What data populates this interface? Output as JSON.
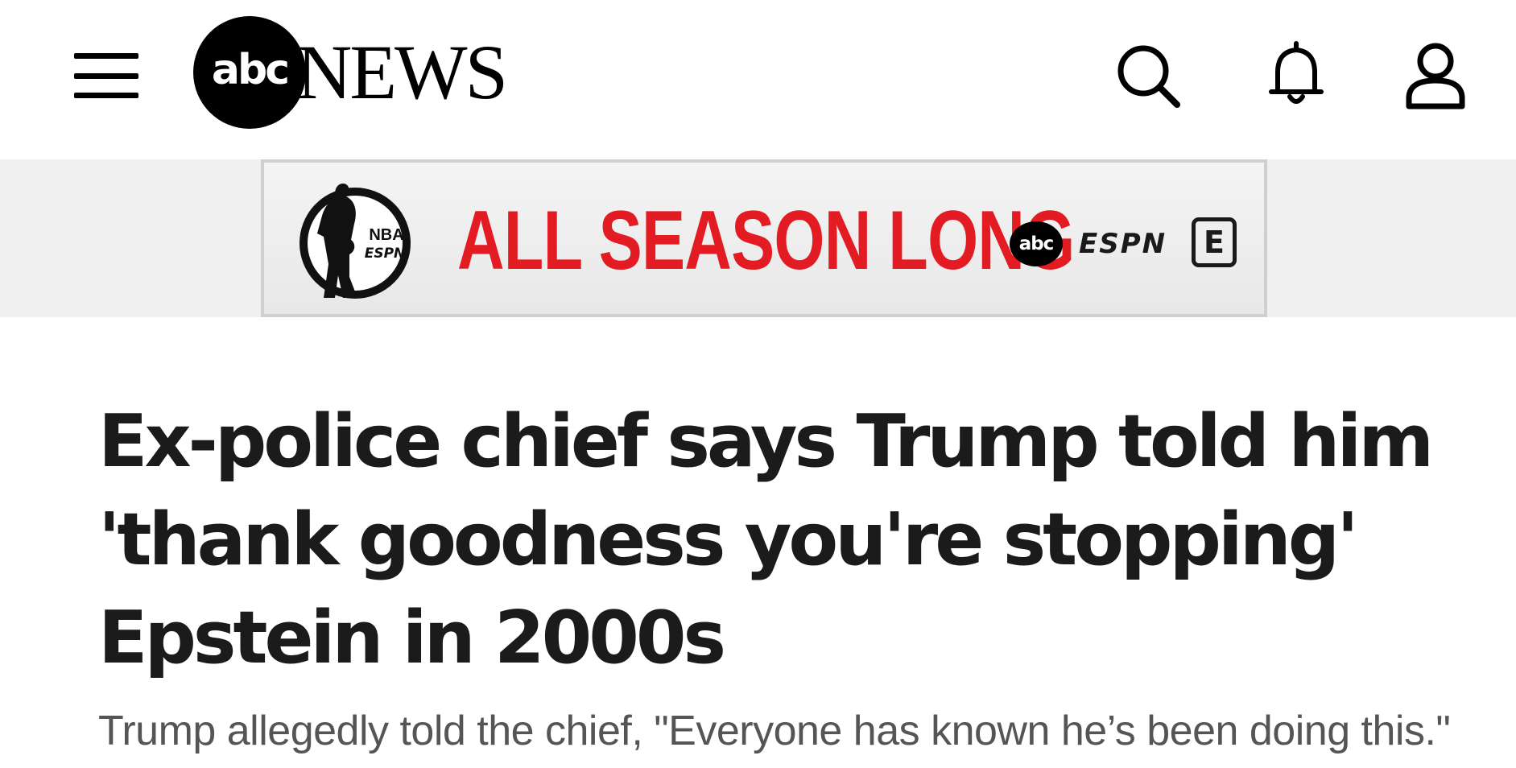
{
  "header": {
    "logo_mark": "abc",
    "logo_word": "NEWS",
    "icons": [
      "menu-icon",
      "search-icon",
      "bell-icon",
      "user-icon"
    ]
  },
  "ad": {
    "badge_top": "NBA",
    "badge_bottom": "ESPN",
    "headline": "ALL SEASON LONG",
    "network_abc": "abc",
    "network_espn": "ESPN",
    "network_eplus": "E",
    "accent_color": "#e31b23"
  },
  "article": {
    "headline": "Ex-police chief says Trump told him 'thank goodness you're stopping' Epstein in 2000s",
    "subheadline": "Trump allegedly told the chief, \"Everyone has known he’s been doing this.\""
  }
}
